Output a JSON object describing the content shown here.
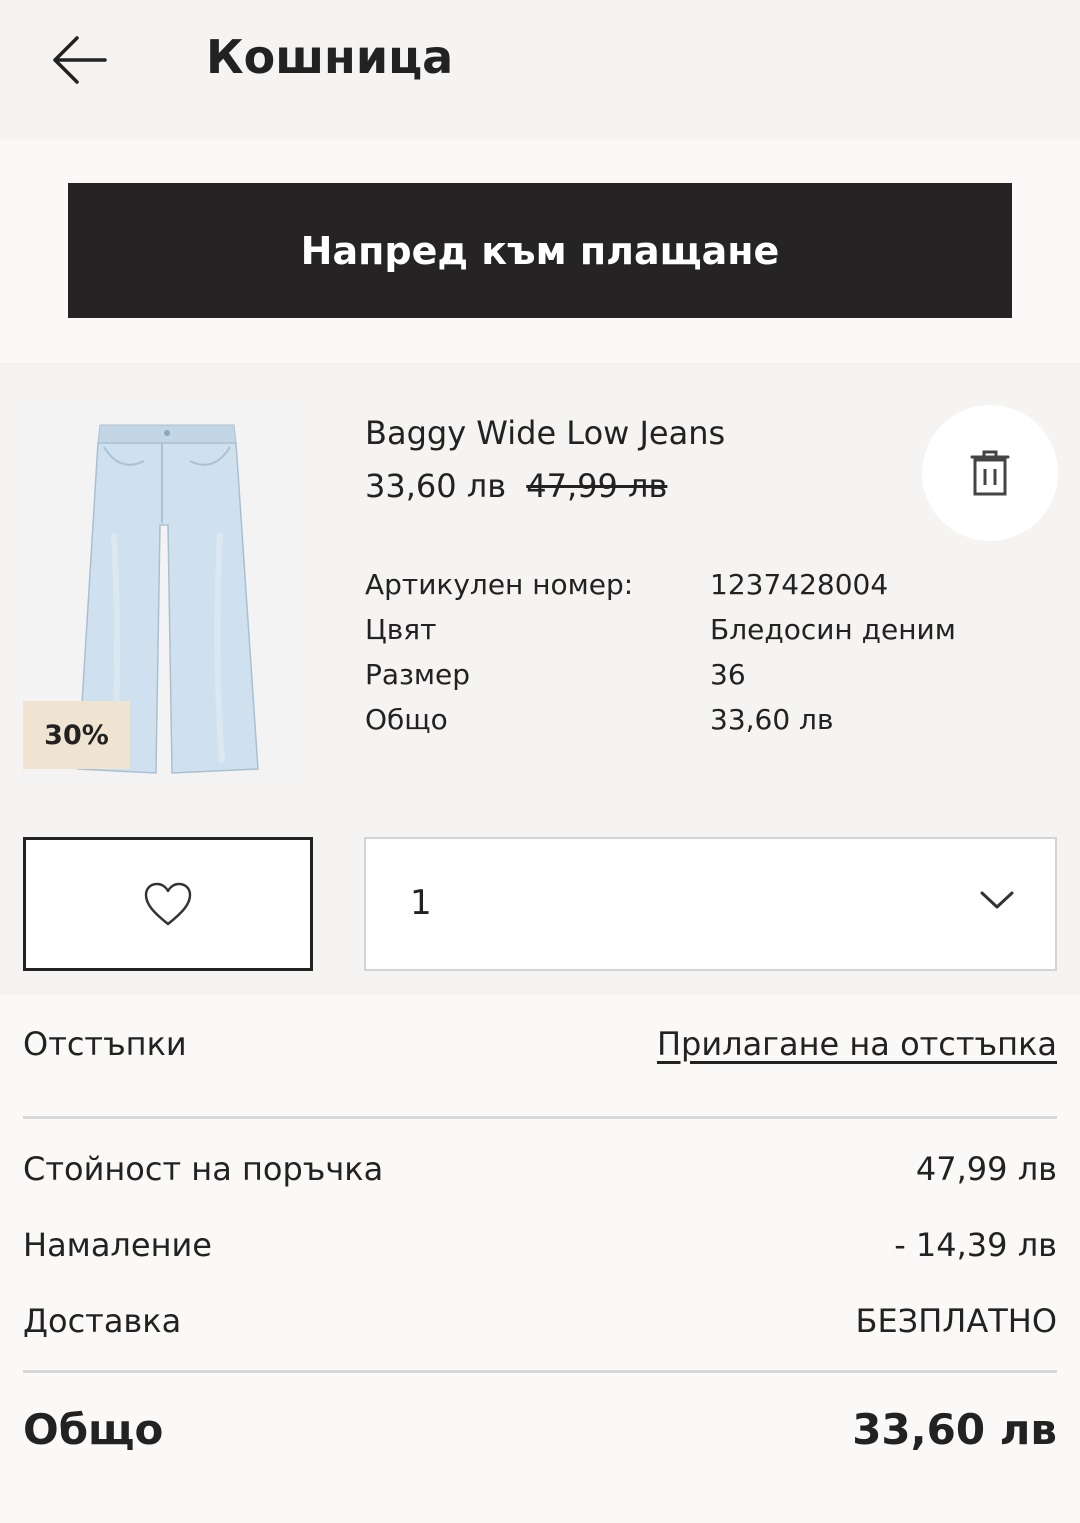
{
  "header": {
    "title": "Кошница"
  },
  "checkout": {
    "label": "Напред към плащане"
  },
  "item": {
    "name": "Baggy Wide Low Jeans",
    "price": "33,60 лв",
    "old_price": "47,99 лв",
    "discount_badge": "30%",
    "details": [
      {
        "label": "Артикулен номер:",
        "value": "1237428004"
      },
      {
        "label": "Цвят",
        "value": "Бледосин деним"
      },
      {
        "label": "Размер",
        "value": "36"
      },
      {
        "label": "Общо",
        "value": "33,60 лв"
      }
    ],
    "quantity": "1"
  },
  "summary": {
    "discounts_label": "Отстъпки",
    "apply_discount_link": "Прилагане на отстъпка",
    "order_value_label": "Стойност на поръчка",
    "order_value": "47,99 лв",
    "reduction_label": "Намаление",
    "reduction_value": "- 14,39 лв",
    "delivery_label": "Доставка",
    "delivery_value": "БЕЗПЛАТНО",
    "total_label": "Общо",
    "total_value": "33,60 лв"
  },
  "colors": {
    "button_dark": "#252323",
    "badge_bg": "#efe4d1",
    "denim": "#c9dcea"
  },
  "icons": [
    "back-arrow-icon",
    "trash-icon",
    "heart-icon",
    "chevron-down-icon"
  ]
}
